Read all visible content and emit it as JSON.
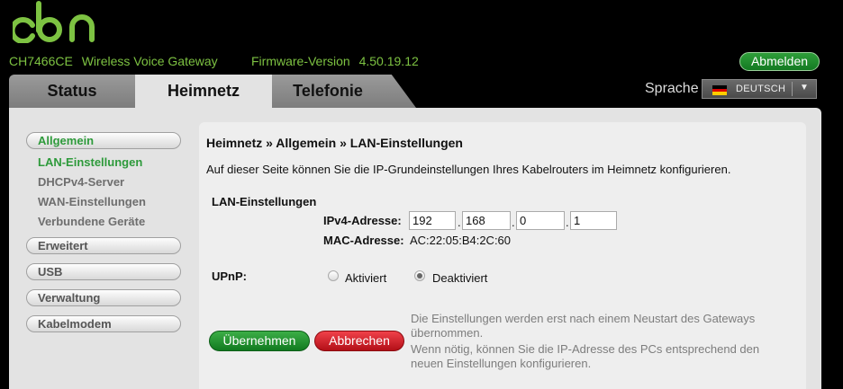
{
  "brand": {
    "logo_text": "cbn",
    "accent": "#7dc242"
  },
  "header": {
    "model": "CH7466CE",
    "product": "Wireless Voice Gateway",
    "fw_label": "Firmware-Version",
    "fw_value": "4.50.19.12",
    "logout_label": "Abmelden"
  },
  "tabs": [
    {
      "label": "Status",
      "active": false
    },
    {
      "label": "Heimnetz",
      "active": true
    },
    {
      "label": "Telefonie",
      "active": false
    }
  ],
  "language": {
    "label": "Sprache",
    "selected": "DEUTSCH",
    "flag": "de-flag-icon"
  },
  "sidebar": {
    "groups": [
      {
        "label": "Allgemein",
        "active": true
      },
      {
        "label": "Erweitert",
        "active": false
      },
      {
        "label": "USB",
        "active": false
      },
      {
        "label": "Verwaltung",
        "active": false
      },
      {
        "label": "Kabelmodem",
        "active": false
      }
    ],
    "sub_items": [
      {
        "label": "LAN-Einstellungen",
        "active": true
      },
      {
        "label": "DHCPv4-Server",
        "active": false
      },
      {
        "label": "WAN-Einstellungen",
        "active": false
      },
      {
        "label": "Verbundene Geräte",
        "active": false
      }
    ]
  },
  "main": {
    "breadcrumb": "Heimnetz » Allgemein » LAN-Einstellungen",
    "description": "Auf dieser Seite können Sie die IP-Grundeinstellungen Ihres Kabelrouters im Heimnetz konfigurieren.",
    "section_title": "LAN-Einstellungen",
    "ipv4_label": "IPv4-Adresse:",
    "ipv4": [
      "192",
      "168",
      "0",
      "1"
    ],
    "ip_separator": ".",
    "mac_label": "MAC-Adresse:",
    "mac_value": "AC:22:05:B4:2C:60",
    "upnp_label": "UPnP:",
    "upnp_options": [
      {
        "label": "Aktiviert",
        "selected": false
      },
      {
        "label": "Deaktiviert",
        "selected": true
      }
    ],
    "apply_label": "Übernehmen",
    "cancel_label": "Abbrechen",
    "note1_line1": "Die Einstellungen werden erst nach einem Neustart des Gateways",
    "note1_line2": "übernommen.",
    "note2_line1": "Wenn nötig, können Sie die IP-Adresse des PCs entsprechend den",
    "note2_line2": "neuen Einstellungen konfigurieren."
  },
  "colors": {
    "active_green": "#2e9a3b",
    "apply_green": "#1f8c2c",
    "cancel_red": "#d0252d"
  }
}
